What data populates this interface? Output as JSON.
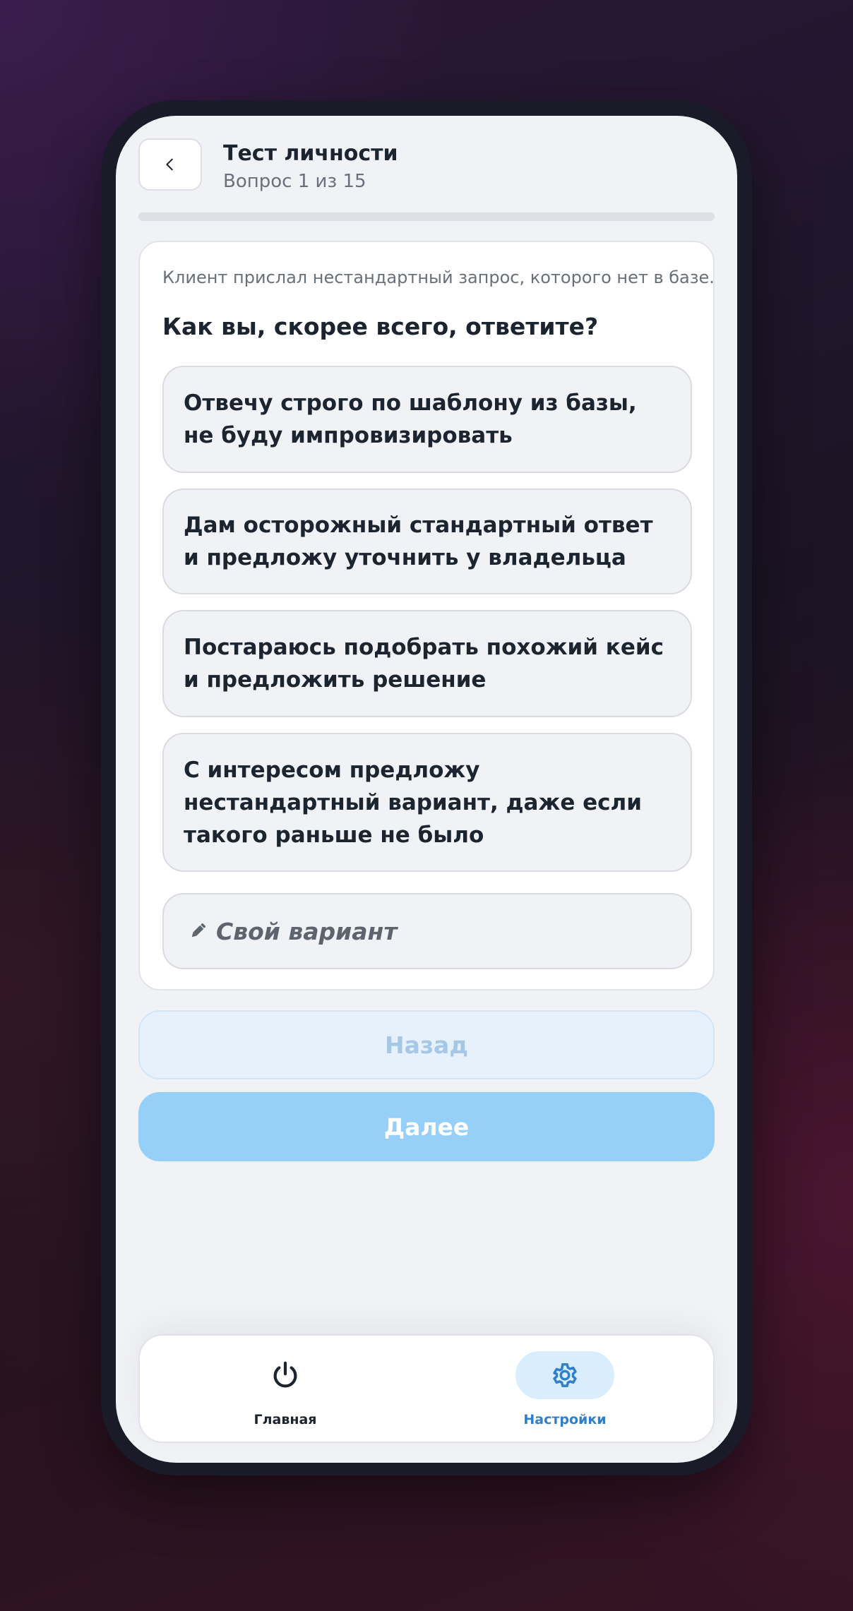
{
  "header": {
    "title": "Тест личности",
    "subtitle": "Вопрос 1 из 15",
    "back_icon": "chevron-left-icon"
  },
  "progress": {
    "current": 1,
    "total": 15,
    "fill_fraction": 0
  },
  "question": {
    "context": "Клиент прислал нестандартный запрос, которого нет в базе.",
    "text": "Как вы, скорее всего, ответите?",
    "options": [
      {
        "label": "Отвечу строго по шаблону из базы, не буду импровизировать"
      },
      {
        "label": "Дам осторожный стандартный ответ и предложу уточнить у владельца"
      },
      {
        "label": "Постараюсь подобрать похожий кейс и предложить решение"
      },
      {
        "label": "С интересом предложу нестандартный вариант, даже если такого раньше не было"
      }
    ],
    "custom_option": {
      "icon": "pencil-icon",
      "label": "Свой вариант"
    }
  },
  "buttons": {
    "back_label": "Назад",
    "next_label": "Далее"
  },
  "tabbar": {
    "items": [
      {
        "label": "Главная",
        "icon": "power-icon",
        "active": false
      },
      {
        "label": "Настройки",
        "icon": "gear-icon",
        "active": true
      }
    ]
  },
  "colors": {
    "accent": "#2f7fcb",
    "next_button": "#96cff8",
    "back_button": "#e6f1fb",
    "screen_bg": "#f1f2f6",
    "text_primary": "#1c2430"
  }
}
